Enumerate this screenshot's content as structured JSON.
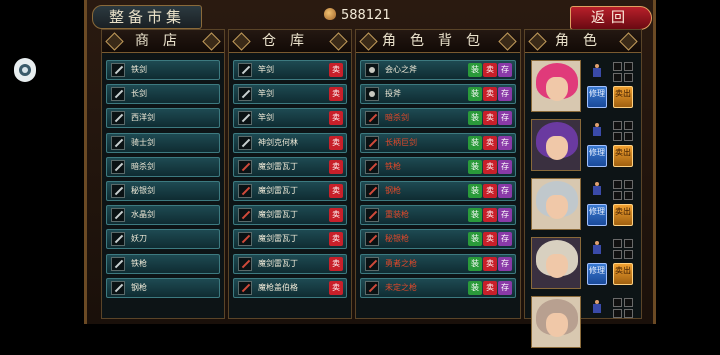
{
  "title": "整备市集",
  "money": "588121",
  "back_label": "返回",
  "headers": {
    "shop": "商店",
    "warehouse": "仓库",
    "bag": "角色背包",
    "role": "角色"
  },
  "shop_items": [
    "铁剑",
    "长剑",
    "西洋剑",
    "骑士剑",
    "暗杀剑",
    "秘银剑",
    "水晶剑",
    "妖刀",
    "铁枪",
    "钢枪"
  ],
  "warehouse_items": [
    "竿剑",
    "竿剑",
    "竿剑",
    "神剑克何林",
    "魔剑雷瓦丁",
    "魔剑雷瓦丁",
    "魔剑雷瓦丁",
    "魔剑雷瓦丁",
    "魔剑雷瓦丁",
    "魔枪盖伯格"
  ],
  "warehouse_tag": "卖",
  "bag_items": [
    {
      "name": "会心之斧",
      "red": false
    },
    {
      "name": "投斧",
      "red": false
    },
    {
      "name": "暗杀剑",
      "red": true
    },
    {
      "name": "长柄巨剑",
      "red": true
    },
    {
      "name": "铁枪",
      "red": true
    },
    {
      "name": "钢枪",
      "red": true
    },
    {
      "name": "重装枪",
      "red": true
    },
    {
      "name": "秘银枪",
      "red": true
    },
    {
      "name": "勇者之枪",
      "red": true
    },
    {
      "name": "未定之枪",
      "red": true
    }
  ],
  "bag_tags": {
    "green": "装",
    "red": "卖",
    "purple": "存"
  },
  "role_buttons": {
    "blue": "修理",
    "gold": "卖出"
  },
  "characters": [
    {
      "name": "char-1",
      "hair": "#e03a7a"
    },
    {
      "name": "char-2",
      "hair": "#6a3aa0"
    },
    {
      "name": "char-3",
      "hair": "#c0c8cc"
    },
    {
      "name": "char-4",
      "hair": "#d8d0c0"
    },
    {
      "name": "char-5",
      "hair": "#b8a090"
    }
  ]
}
